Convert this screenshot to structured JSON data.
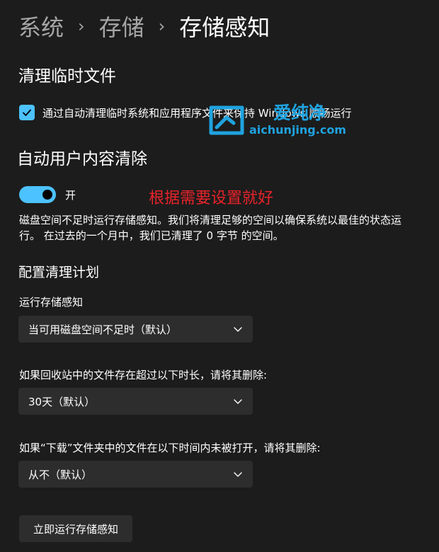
{
  "breadcrumb": {
    "items": [
      "系统",
      "存储",
      "存储感知"
    ],
    "separator": "›"
  },
  "temp_files": {
    "heading": "清理临时文件",
    "checkbox_label": "通过自动清理临时系统和应用程序文件来保持 Windows 顺畅运行",
    "checked": true
  },
  "auto_cleanup": {
    "heading": "自动用户内容清除",
    "toggle_state": "开",
    "toggle_on": true,
    "description": "磁盘空间不足时运行存储感知。我们将清理足够的空间以确保系统以最佳的状态运行。 在过去的一个月中，我们已清理了 0 字节 的空间。"
  },
  "annotation": "根据需要设置就好",
  "schedule": {
    "heading": "配置清理计划",
    "run_label": "运行存储感知",
    "run_value": "当可用磁盘空间不足时（默认）",
    "recycle_label": "如果回收站中的文件存在超过以下时长，请将其删除:",
    "recycle_value": "30天（默认）",
    "downloads_label": "如果“下载”文件夹中的文件在以下时间内未被打开，请将其删除:",
    "downloads_value": "从不（默认）"
  },
  "run_now_button": "立即运行存储感知",
  "watermark": {
    "name": "爱纯净",
    "url": "aichunjing.com"
  },
  "colors": {
    "background": "#1c1c1c",
    "accent": "#4cc2ff",
    "annotation": "#e8232a",
    "watermark": "#1fa3e0",
    "control": "#2d2d2d"
  },
  "icons": [
    "chevron-right-icon",
    "checkmark-icon",
    "chevron-down-icon",
    "watermark-logo-icon"
  ]
}
